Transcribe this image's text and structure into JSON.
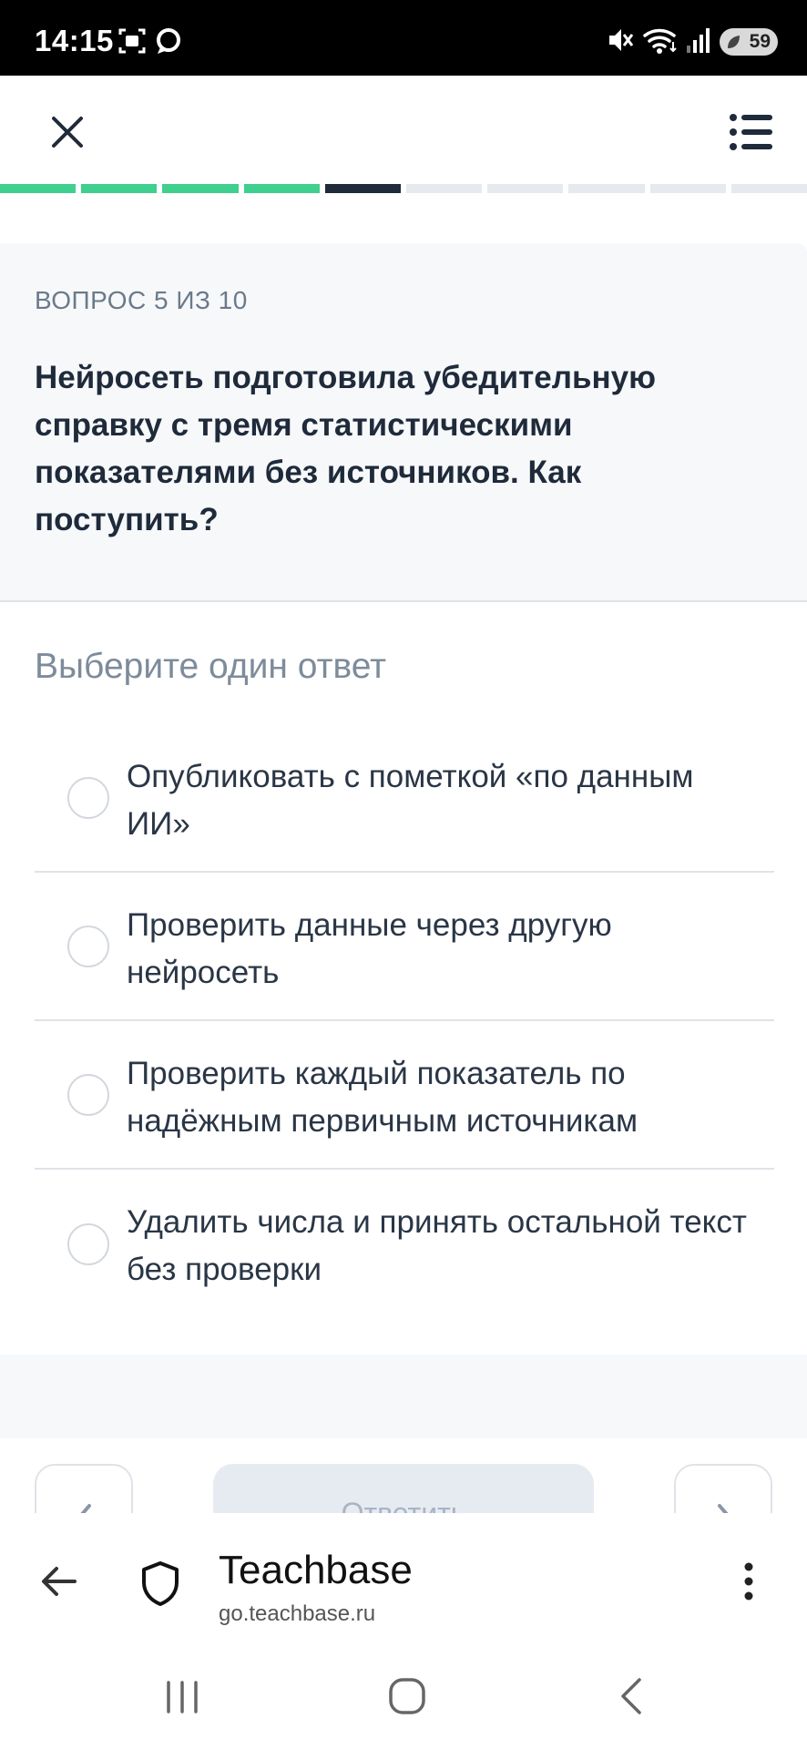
{
  "status_bar": {
    "time": "14:15",
    "battery": "59"
  },
  "progress": {
    "total": 10,
    "completed": 4,
    "current": 5,
    "colors": {
      "completed": "#3fcf8e",
      "current": "#1f2a3a",
      "pending": "#e6e9ee"
    }
  },
  "question": {
    "counter": "ВОПРОС 5 ИЗ 10",
    "text": "Нейросеть подготовила убедительную справку с тремя статистическими показателями без источников. Как поступить?"
  },
  "answers": {
    "label": "Выберите один ответ",
    "options": [
      "Опубликовать с пометкой «по данным ИИ»",
      "Проверить данные через другую нейросеть",
      "Проверить каждый показатель по надёжным первичным источникам",
      "Удалить числа и принять остальной текст без проверки"
    ]
  },
  "actions": {
    "submit_label": "Ответить"
  },
  "browser": {
    "title": "Teachbase",
    "url": "go.teachbase.ru"
  },
  "icons": {
    "close": "close-icon",
    "menu": "list-menu-icon",
    "back": "arrow-left-icon",
    "security": "shield-icon",
    "more": "more-vertical-icon"
  }
}
